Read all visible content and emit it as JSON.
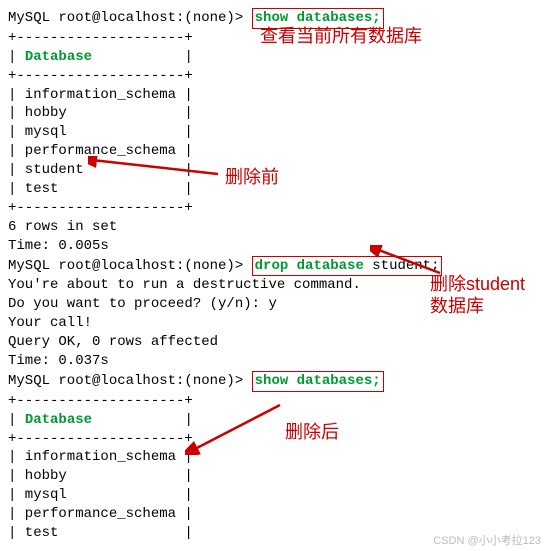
{
  "prompt": "MySQL root@localhost:(none)> ",
  "cmds": {
    "show": "show databases;",
    "drop_pre": "drop database",
    "drop_post": " student;"
  },
  "border": {
    "top": "+--------------------+",
    "header": "| ",
    "hname": "Database",
    "hpad": "           |",
    "r_info": "| information_schema |",
    "r_hobby": "| hobby              |",
    "r_mysql": "| mysql              |",
    "r_perf": "| performance_schema |",
    "r_stud": "| student",
    "r_stud_pad": "            |",
    "r_test": "| test               |"
  },
  "msgs": {
    "rows6": "6 rows in set",
    "t1": "Time: 0.005s",
    "warn": "You're about to run a destructive command.",
    "ask": "Do you want to proceed? (y/n): y",
    "call": "Your call!",
    "ok": "Query OK, 0 rows affected",
    "t2": "Time: 0.037s"
  },
  "annot": {
    "a1": "查看当前所有数据库",
    "a2": "删除前",
    "a3": "删除student",
    "a3b": "数据库",
    "a4": "删除后"
  },
  "watermark": "CSDN @小小考拉123"
}
